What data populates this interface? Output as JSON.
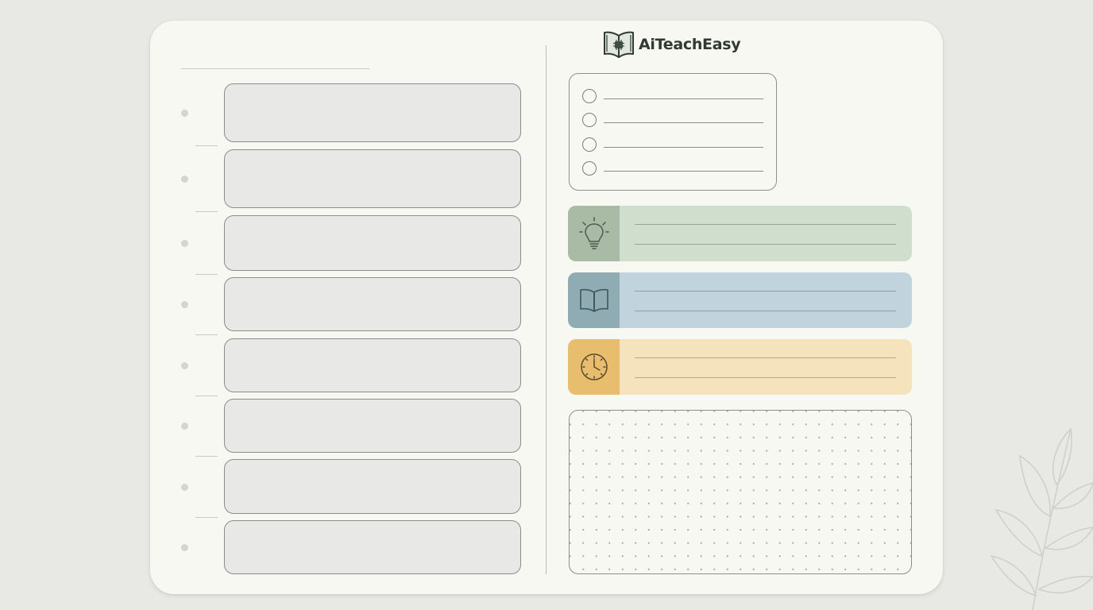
{
  "brand": {
    "name": "AiTeachEasy",
    "icon": "open-book-chip-icon",
    "color": "#2f3a32"
  },
  "schedule": {
    "slot_count": 8,
    "slot_fill": "#e8e8e7"
  },
  "checklist": {
    "items": [
      "",
      "",
      "",
      ""
    ]
  },
  "notes": [
    {
      "icon": "lightbulb-icon",
      "accent": "#a9bba5",
      "fill": "#d0dfcd"
    },
    {
      "icon": "book-icon",
      "accent": "#8fabb4",
      "fill": "#c1d4dd"
    },
    {
      "icon": "clock-icon",
      "accent": "#e8be6e",
      "fill": "#f4e3bd"
    }
  ],
  "dot_grid": {
    "label": ""
  }
}
